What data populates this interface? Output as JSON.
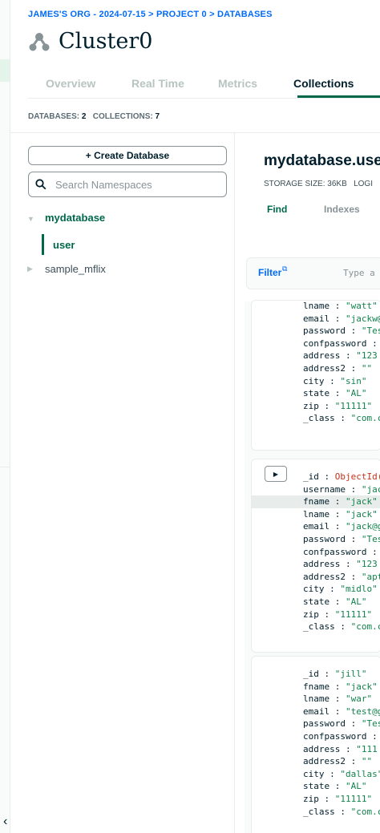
{
  "breadcrumb": "JAMES'S ORG - 2024-07-15 > PROJECT 0 > DATABASES",
  "cluster": {
    "name": "Cluster0"
  },
  "tabs": [
    {
      "label": "Overview"
    },
    {
      "label": "Real Time"
    },
    {
      "label": "Metrics"
    },
    {
      "label": "Collections"
    }
  ],
  "counts": {
    "databases_label": "DATABASES:",
    "databases": "2",
    "collections_label": "COLLECTIONS:",
    "collections": "7"
  },
  "sidebar": {
    "create_label": "+ Create Database",
    "search_placeholder": "Search Namespaces",
    "databases": [
      {
        "label": "mydatabase"
      },
      {
        "label": "sample_mflix"
      }
    ],
    "active_collection": "user"
  },
  "main": {
    "namespace": "mydatabase.user",
    "storage_label": "STORAGE SIZE:",
    "storage_value": "36KB",
    "logical_label": "LOGI",
    "sub_tabs": [
      {
        "label": "Find"
      },
      {
        "label": "Indexes"
      }
    ],
    "filter_label": "Filter",
    "filter_placeholder": "Type a"
  },
  "documents": [
    {
      "fields": [
        {
          "key": "lname",
          "value": "\"watt\""
        },
        {
          "key": "email",
          "value": "\"jackw@"
        },
        {
          "key": "password",
          "value": "\"Tes"
        },
        {
          "key": "confpassword",
          "value": ""
        },
        {
          "key": "address",
          "value": "\"123"
        },
        {
          "key": "address2",
          "value": "\"\""
        },
        {
          "key": "city",
          "value": "\"sin\""
        },
        {
          "key": "state",
          "value": "\"AL\""
        },
        {
          "key": "zip",
          "value": "\"11111\""
        },
        {
          "key": "_class",
          "value": "\"com.c"
        }
      ]
    },
    {
      "fields": [
        {
          "key": "_id",
          "value": "ObjectId('"
        },
        {
          "key": "username",
          "value": "\"jac"
        },
        {
          "key": "fname",
          "value": "\"jack\""
        },
        {
          "key": "lname",
          "value": "\"jack\""
        },
        {
          "key": "email",
          "value": "\"jack@g"
        },
        {
          "key": "password",
          "value": "\"Tes"
        },
        {
          "key": "confpassword",
          "value": ""
        },
        {
          "key": "address",
          "value": "\"123"
        },
        {
          "key": "address2",
          "value": "\"apt"
        },
        {
          "key": "city",
          "value": "\"midlo\""
        },
        {
          "key": "state",
          "value": "\"AL\""
        },
        {
          "key": "zip",
          "value": "\"11111\""
        },
        {
          "key": "_class",
          "value": "\"com.c"
        }
      ]
    },
    {
      "fields": [
        {
          "key": "_id",
          "value": "\"jill\""
        },
        {
          "key": "fname",
          "value": "\"jack\""
        },
        {
          "key": "lname",
          "value": "\"war\""
        },
        {
          "key": "email",
          "value": "\"test@g"
        },
        {
          "key": "password",
          "value": "\"Tes"
        },
        {
          "key": "confpassword",
          "value": ""
        },
        {
          "key": "address",
          "value": "\"111"
        },
        {
          "key": "address2",
          "value": "\"\""
        },
        {
          "key": "city",
          "value": "\"dallas\""
        },
        {
          "key": "state",
          "value": "\"AL\""
        },
        {
          "key": "zip",
          "value": "\"11111\""
        },
        {
          "key": "_class",
          "value": "\"com.c"
        }
      ]
    }
  ],
  "colors": {
    "accent": "#00684a",
    "link": "#016bf8",
    "objectid": "#c4331b"
  }
}
